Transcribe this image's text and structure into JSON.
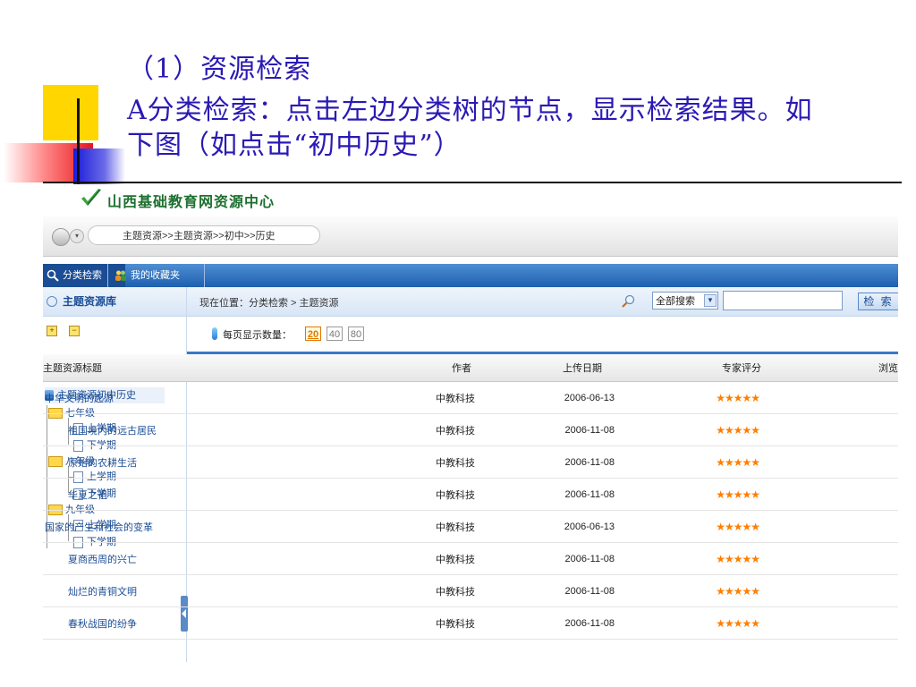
{
  "slide": {
    "line1": "（1）资源检索",
    "line2": "A分类检索：点击左边分类树的节点，显示检索结果。如",
    "line3": "下图（如点击“初中历史”）"
  },
  "app": {
    "logo_text": "山西基础教育网资源中心",
    "breadcrumb_address": "主题资源>>主题资源>>初中>>历史"
  },
  "nav": {
    "tabs": [
      {
        "label": "分类检索"
      },
      {
        "label": "我的收藏夹"
      }
    ]
  },
  "sidebar": {
    "title": "主题资源库",
    "expand_all": "+",
    "collapse_all": "−",
    "root_label": "主题资源初中历史",
    "grades": [
      {
        "label": "七年级",
        "terms": [
          "上学期",
          "下学期"
        ]
      },
      {
        "label": "八年级",
        "terms": [
          "上学期",
          "下学期"
        ]
      },
      {
        "label": "九年级",
        "terms": [
          "上学期",
          "下学期"
        ]
      }
    ]
  },
  "location": {
    "text": "现在位置：分类检索 > 主题资源"
  },
  "search": {
    "scope_selected": "全部搜索",
    "input_value": "",
    "button_label": "检 索"
  },
  "paging": {
    "label": "每页显示数量：",
    "options": [
      "20",
      "40",
      "80"
    ],
    "selected": "20"
  },
  "table": {
    "headers": {
      "title": "主题资源标题",
      "author": "作者",
      "date": "上传日期",
      "rating": "专家评分",
      "views": "浏览"
    },
    "rows": [
      {
        "title": "中华文明的起源",
        "author": "中教科技",
        "date": "2006-06-13",
        "rating": "★★★★★",
        "indent": false
      },
      {
        "title": "祖国境内的远古居民",
        "author": "中教科技",
        "date": "2006-11-08",
        "rating": "★★★★★",
        "indent": true
      },
      {
        "title": "原始的农耕生活",
        "author": "中教科技",
        "date": "2006-11-08",
        "rating": "★★★★★",
        "indent": true
      },
      {
        "title": "华夏之祖",
        "author": "中教科技",
        "date": "2006-11-08",
        "rating": "★★★★★",
        "indent": true
      },
      {
        "title": "国家的产生和社会的变革",
        "author": "中教科技",
        "date": "2006-06-13",
        "rating": "★★★★★",
        "indent": false
      },
      {
        "title": "夏商西周的兴亡",
        "author": "中教科技",
        "date": "2006-11-08",
        "rating": "★★★★★",
        "indent": true
      },
      {
        "title": "灿烂的青铜文明",
        "author": "中教科技",
        "date": "2006-11-08",
        "rating": "★★★★★",
        "indent": true
      },
      {
        "title": "春秋战国的纷争",
        "author": "中教科技",
        "date": "2006-11-08",
        "rating": "★★★★★",
        "indent": true
      }
    ],
    "rating_count": 5
  },
  "colors": {
    "slide_text": "#2a1ab4",
    "nav_blue": "#1e5fae",
    "link_blue": "#1b4d95",
    "star_orange": "#ff7e00",
    "accent_yellow": "#ffd600",
    "accent_red": "#e8141a"
  }
}
